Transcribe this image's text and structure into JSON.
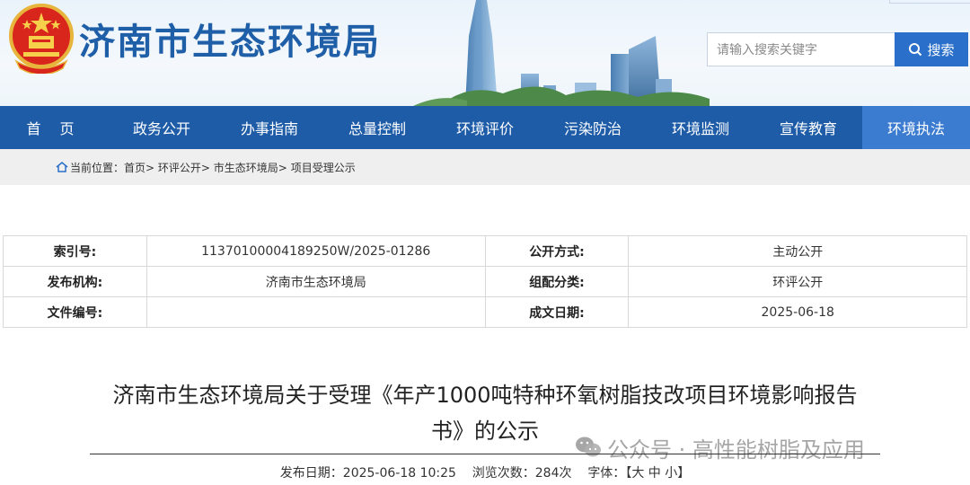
{
  "header": {
    "site_title": "济南市生态环境局",
    "search_placeholder": "请输入搜索关键字",
    "search_button": "搜索"
  },
  "nav": {
    "items": [
      "首 页",
      "政务公开",
      "办事指南",
      "总量控制",
      "环境评价",
      "污染防治",
      "环境监测",
      "宣传教育",
      "环境执法"
    ],
    "active_index": 8
  },
  "breadcrumb": {
    "prefix": "当前位置：",
    "items": [
      "首页>",
      "环评公开>",
      "市生态环境局>",
      "项目受理公示"
    ]
  },
  "info": {
    "index_label": "索引号:",
    "index_value": "11370100004189250W/2025-01286",
    "publish_mode_label": "公开方式:",
    "publish_mode_value": "主动公开",
    "publisher_label": "发布机构:",
    "publisher_value": "济南市生态环境局",
    "category_label": "组配分类:",
    "category_value": "环评公开",
    "doc_no_label": "文件编号:",
    "doc_no_value": "",
    "date_label": "成文日期:",
    "date_value": "2025-06-18"
  },
  "article": {
    "title_line1": "济南市生态环境局关于受理《年产1000吨特种环氧树脂技改项目环境影响报告",
    "title_line2": "书》的公示",
    "meta_publish_label": "发布日期：",
    "meta_publish_value": "2025-06-18 10:25",
    "meta_views_label": "浏览次数：",
    "meta_views_value": "284次",
    "meta_font_label": "字体：",
    "meta_font_open": "【",
    "meta_font_large": "大",
    "meta_font_medium": "中",
    "meta_font_small": "小",
    "meta_font_close": "】"
  },
  "watermark": {
    "text": "公众号 · 高性能树脂及应用"
  },
  "colors": {
    "nav_bg": "#1e5ca8",
    "nav_active": "#3b7bd0",
    "title_blue": "#1f5fa8",
    "search_btn": "#2a6fc9"
  }
}
